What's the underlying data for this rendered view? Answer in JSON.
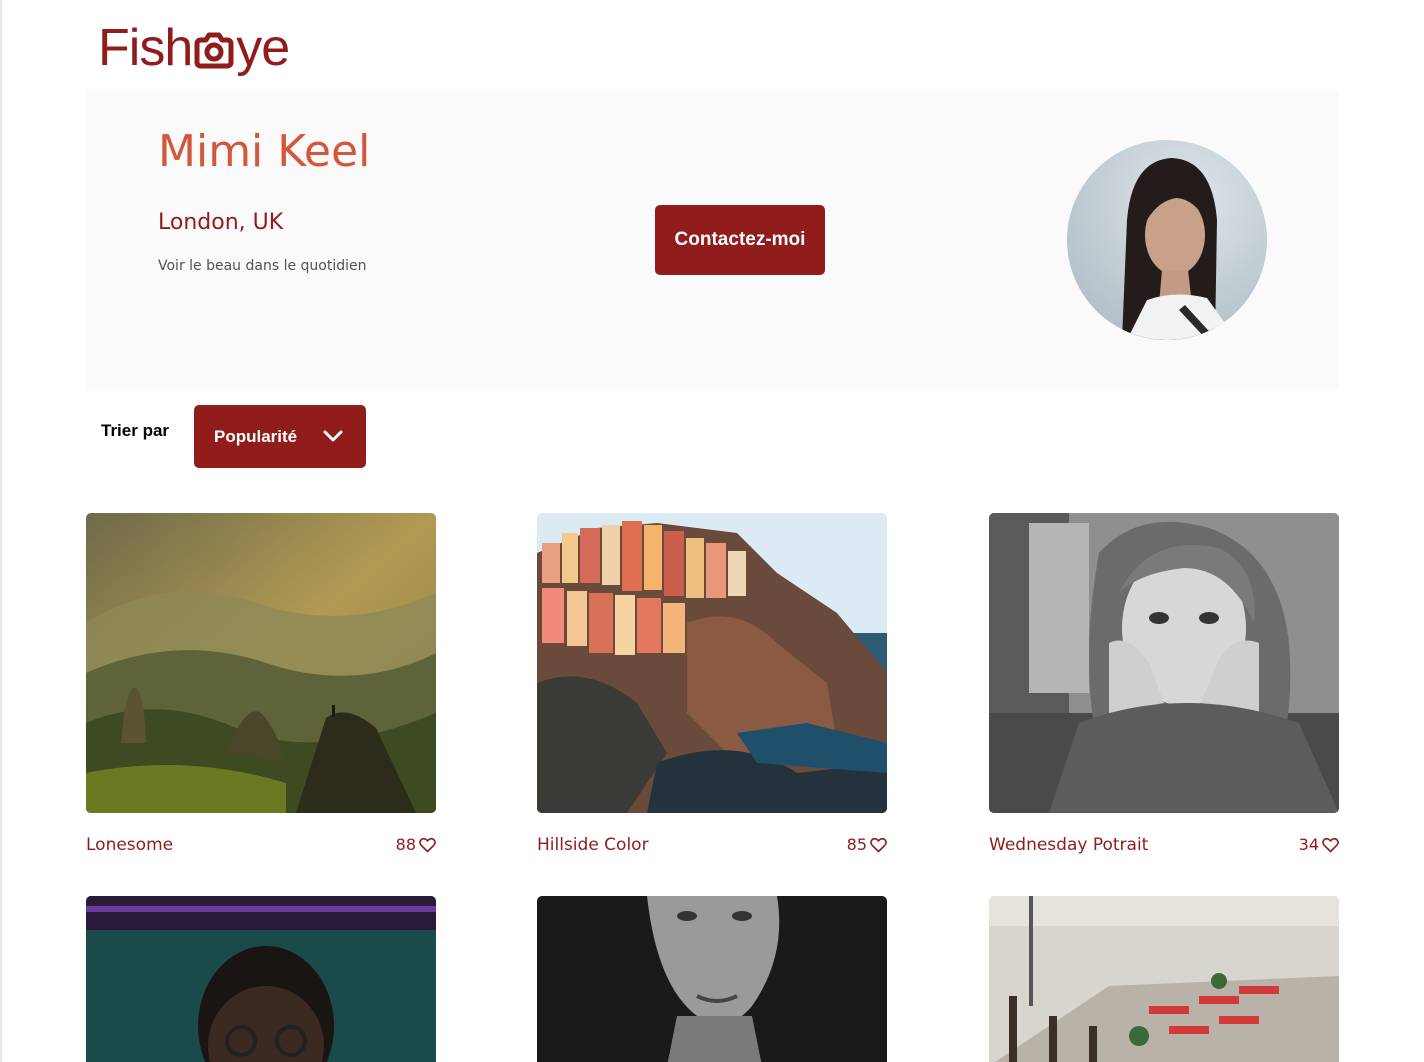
{
  "logo": {
    "text_before": "Fish",
    "text_after": "ye",
    "icon": "camera-icon",
    "color": "#901c1c"
  },
  "photographer": {
    "name": "Mimi Keel",
    "location": "London, UK",
    "tagline": "Voir le beau dans le quotidien",
    "contact_label": "Contactez-moi",
    "avatar_icon": "portrait-avatar"
  },
  "sort": {
    "label": "Trier par",
    "selected": "Popularité",
    "icon": "chevron-down-icon"
  },
  "gallery": [
    {
      "title": "Lonesome",
      "likes": "88"
    },
    {
      "title": "Hillside Color",
      "likes": "85"
    },
    {
      "title": "Wednesday Potrait",
      "likes": "34"
    },
    {
      "title": "",
      "likes": ""
    },
    {
      "title": "",
      "likes": ""
    },
    {
      "title": "",
      "likes": ""
    }
  ],
  "colors": {
    "primary": "#901c1c",
    "name": "#d3573c",
    "banner_bg": "#fafafa"
  }
}
